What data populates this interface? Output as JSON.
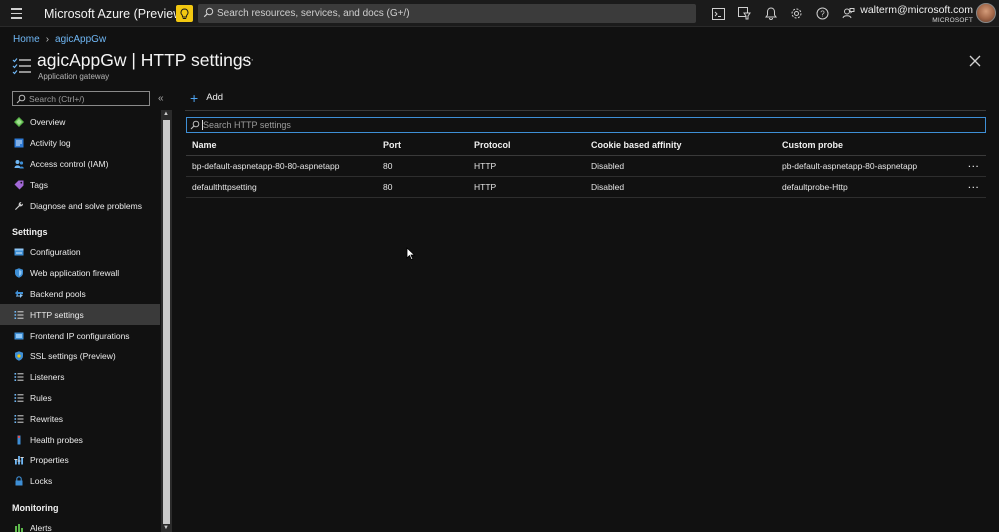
{
  "topbar": {
    "brand": "Microsoft Azure (Preview)",
    "search_placeholder": "Search resources, services, and docs (G+/)",
    "user_email": "walterm@microsoft.com",
    "user_org": "MICROSOFT",
    "icons": [
      "menu-icon",
      "feedback-bulb-icon",
      "cloud-shell-icon",
      "directory-filter-icon",
      "notifications-icon",
      "settings-icon",
      "help-icon",
      "feedback-icon"
    ],
    "accent_color": "#f2c811"
  },
  "breadcrumb": {
    "home": "Home",
    "resource": "agicAppGw"
  },
  "header": {
    "title": "agicAppGw | HTTP settings",
    "subtitle": "Application gateway",
    "more": "···"
  },
  "sidebar": {
    "search_placeholder": "Search (Ctrl+/)",
    "collapse": "«",
    "top_items": [
      {
        "label": "Overview",
        "icon": "overview-icon"
      },
      {
        "label": "Activity log",
        "icon": "activity-log-icon"
      },
      {
        "label": "Access control (IAM)",
        "icon": "iam-icon"
      },
      {
        "label": "Tags",
        "icon": "tag-icon"
      },
      {
        "label": "Diagnose and solve problems",
        "icon": "wrench-icon"
      }
    ],
    "settings_header": "Settings",
    "settings_items": [
      {
        "label": "Configuration",
        "icon": "configuration-icon"
      },
      {
        "label": "Web application firewall",
        "icon": "shield-icon"
      },
      {
        "label": "Backend pools",
        "icon": "backend-pool-icon"
      },
      {
        "label": "HTTP settings",
        "icon": "list-icon",
        "selected": true
      },
      {
        "label": "Frontend IP configurations",
        "icon": "frontend-ip-icon"
      },
      {
        "label": "SSL settings (Preview)",
        "icon": "ssl-icon"
      },
      {
        "label": "Listeners",
        "icon": "listeners-icon"
      },
      {
        "label": "Rules",
        "icon": "rules-icon"
      },
      {
        "label": "Rewrites",
        "icon": "rewrites-icon"
      },
      {
        "label": "Health probes",
        "icon": "health-probe-icon"
      },
      {
        "label": "Properties",
        "icon": "properties-icon"
      },
      {
        "label": "Locks",
        "icon": "lock-icon"
      }
    ],
    "monitoring_header": "Monitoring",
    "monitoring_items": [
      {
        "label": "Alerts",
        "icon": "alerts-icon"
      }
    ]
  },
  "main": {
    "add_label": "Add",
    "filter_placeholder": "Search HTTP settings",
    "columns": [
      "Name",
      "Port",
      "Protocol",
      "Cookie based affinity",
      "Custom probe"
    ],
    "rows": [
      {
        "name": "bp-default-aspnetapp-80-80-aspnetapp",
        "port": "80",
        "protocol": "HTTP",
        "affinity": "Disabled",
        "probe": "pb-default-aspnetapp-80-aspnetapp"
      },
      {
        "name": "defaulthttpsetting",
        "port": "80",
        "protocol": "HTTP",
        "affinity": "Disabled",
        "probe": "defaultprobe-Http"
      }
    ],
    "row_menu": "···"
  }
}
